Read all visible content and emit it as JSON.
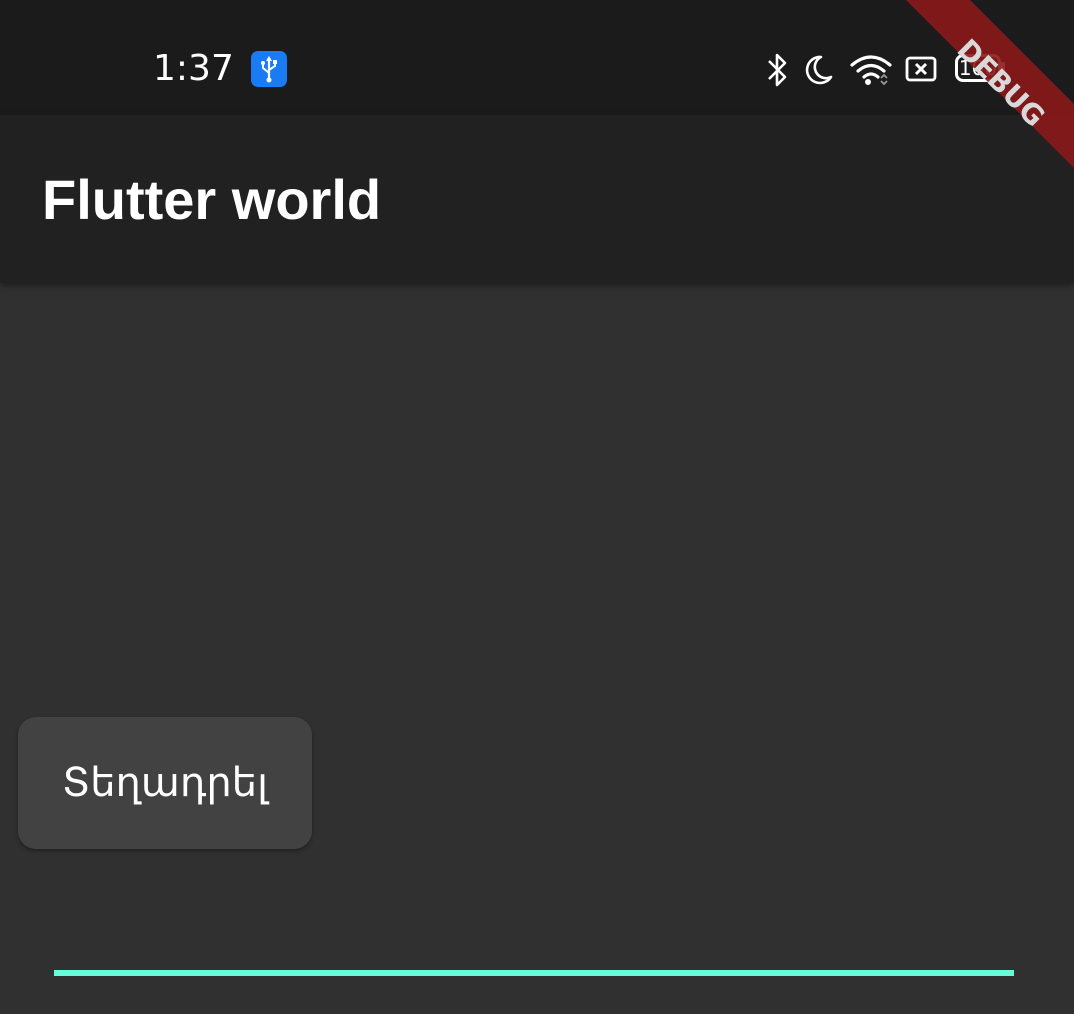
{
  "status_bar": {
    "time": "1:37",
    "battery_level": "100",
    "icons": [
      "usb-icon",
      "bluetooth-icon",
      "do-not-disturb-moon-icon",
      "wifi-icon",
      "no-sim-icon",
      "battery-icon"
    ]
  },
  "app_bar": {
    "title": "Flutter world"
  },
  "content": {
    "tile_label": "Տեղադրել"
  },
  "debug_banner": {
    "label": "DEBUG"
  },
  "colors": {
    "background": "#303030",
    "app_bar": "#212121",
    "status_bar": "#1b1b1b",
    "tile": "#424242",
    "accent": "#64ffda",
    "usb_badge": "#1a7cf5",
    "debug_banner": "#8b1a1a"
  }
}
